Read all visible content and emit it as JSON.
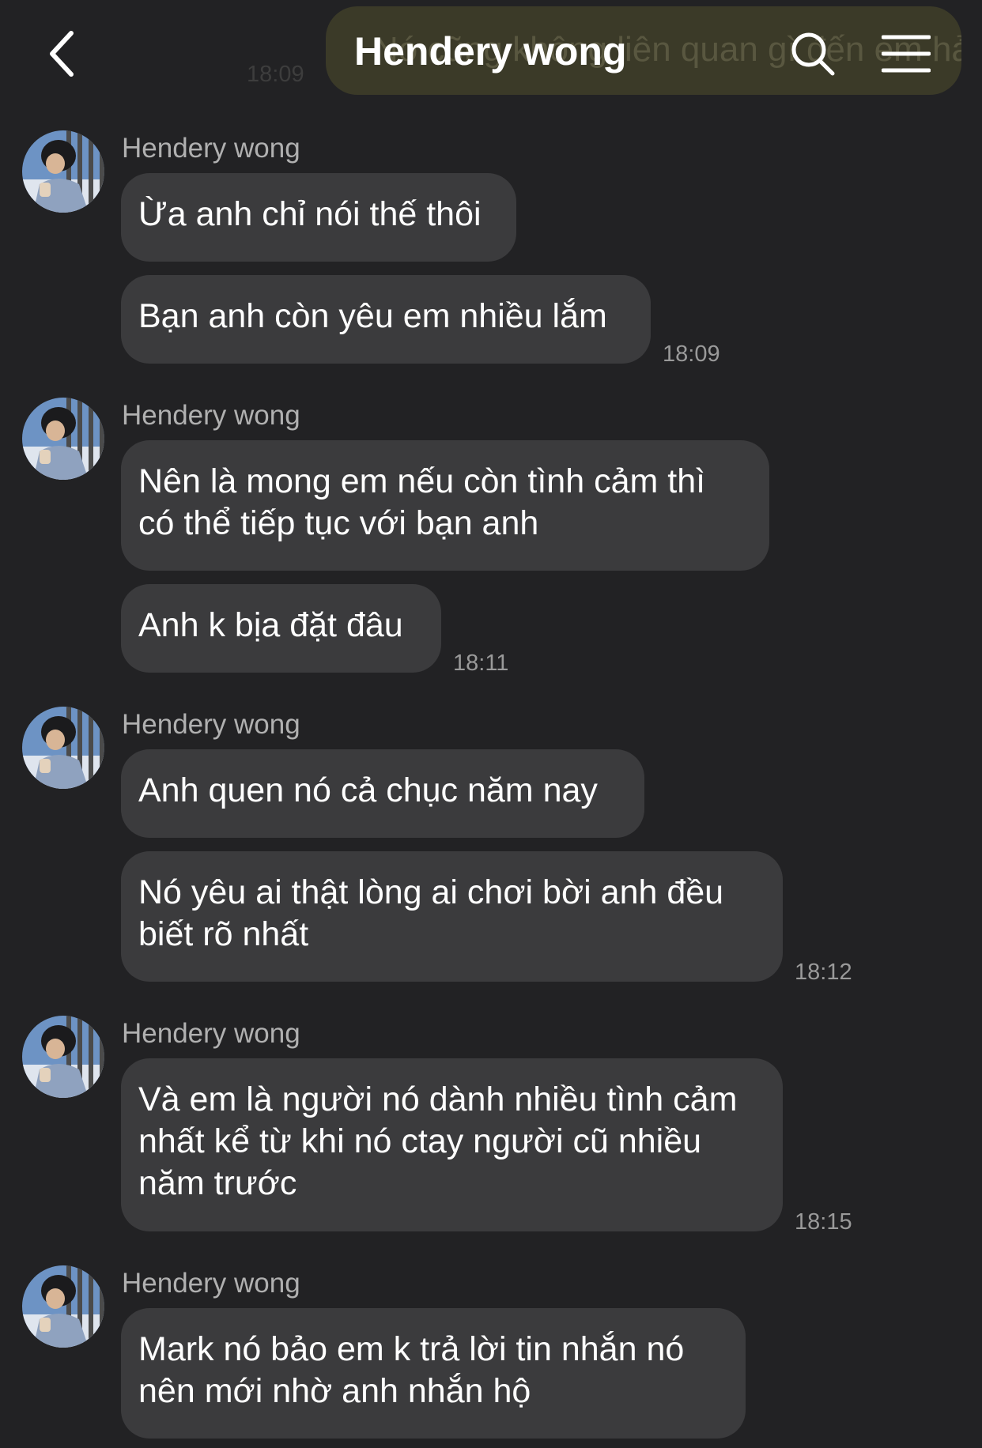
{
  "header": {
    "title": "Hendery wong",
    "behind_message_text": "Nó cũng không liên quan gì đến em hả?",
    "behind_message_time": "18:09"
  },
  "groups": [
    {
      "sender": "Hendery wong",
      "messages": [
        "Ừa anh chỉ nói thế thôi",
        "Bạn anh còn yêu em nhiều lắm"
      ],
      "time": "18:09"
    },
    {
      "sender": "Hendery wong",
      "messages": [
        [
          "Nên là mong em nếu còn tình cảm thì",
          "có thể tiếp tục với bạn anh"
        ],
        "Anh k bịa đặt đâu"
      ],
      "time": "18:11"
    },
    {
      "sender": "Hendery wong",
      "messages": [
        "Anh quen nó cả chục năm nay",
        [
          "Nó yêu ai thật lòng ai chơi bời anh đều",
          "biết rõ nhất"
        ]
      ],
      "time": "18:12"
    },
    {
      "sender": "Hendery wong",
      "messages": [
        [
          "Và em là người nó dành nhiều tình cảm",
          "nhất kể từ khi nó ctay người cũ nhiều",
          "năm trước"
        ]
      ],
      "time": "18:15"
    },
    {
      "sender": "Hendery wong",
      "messages": [
        [
          "Mark nó bảo em k trả lời tin nhắn nó",
          "nên mới nhờ anh nhắn hộ"
        ]
      ]
    }
  ],
  "icons": {
    "back": "chevron-left-icon",
    "search": "search-icon",
    "menu": "hamburger-menu-icon"
  }
}
